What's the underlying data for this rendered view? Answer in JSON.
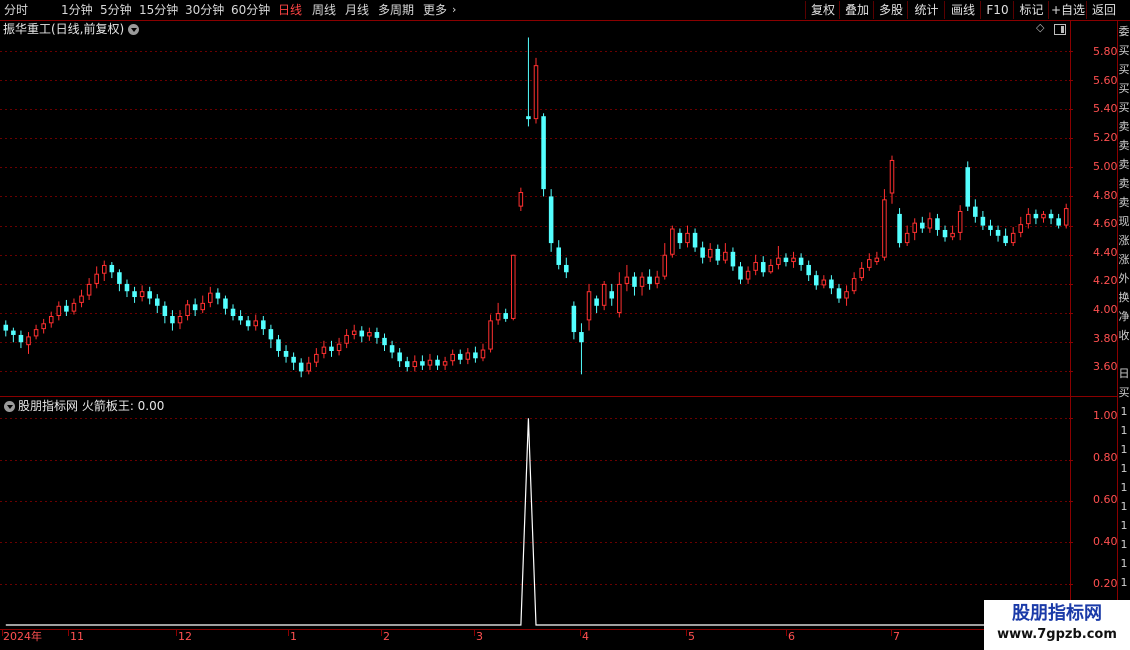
{
  "toolbar": {
    "timeframes": [
      "分时",
      "1分钟",
      "5分钟",
      "15分钟",
      "30分钟",
      "60分钟",
      "日线",
      "周线",
      "月线",
      "多周期",
      "更多"
    ],
    "active_timeframe": "日线",
    "buttons": [
      "复权",
      "叠加",
      "多股",
      "统计",
      "画线",
      "F10",
      "标记",
      "+自选",
      "返回"
    ]
  },
  "main_chart": {
    "title": "振华重工(日线,前复权)",
    "y_ticks": [
      "5.80",
      "5.60",
      "5.40",
      "5.20",
      "5.00",
      "4.80",
      "4.60",
      "4.40",
      "4.20",
      "4.00",
      "3.80",
      "3.60"
    ]
  },
  "indicator": {
    "title": "股朋指标网  火箭板王: 0.00",
    "y_ticks": [
      "1.00",
      "0.80",
      "0.60",
      "0.40",
      "0.20"
    ]
  },
  "x_axis": {
    "labels": [
      "2024年",
      "11",
      "12",
      "1",
      "2",
      "3",
      "4",
      "5",
      "6",
      "7"
    ]
  },
  "right_strip": {
    "chars": [
      "委",
      "买",
      "买",
      "买",
      "买",
      "卖",
      "卖",
      "卖",
      "卖",
      "卖",
      "现",
      "涨",
      "涨",
      "外",
      "换",
      "净",
      "收",
      "",
      "日",
      "买",
      "1",
      "1",
      "1",
      "1",
      "1",
      "1",
      "1",
      "1",
      "1",
      "1"
    ]
  },
  "watermark": {
    "title": "股朋指标网",
    "url": "www.7gpzb.com"
  },
  "colors": {
    "up": "#ff3030",
    "down": "#54ffff",
    "grid": "#6a0000",
    "frame": "#8a0000",
    "tick_label": "#ff5050",
    "indicator_line": "#ffffff"
  },
  "chart_data": {
    "type": "candlestick",
    "price_range": [
      3.5,
      5.9
    ],
    "indicator_range": [
      0,
      1.05
    ],
    "candles": [
      [
        3.92,
        3.88,
        3.95,
        3.84
      ],
      [
        3.88,
        3.85,
        3.9,
        3.8
      ],
      [
        3.85,
        3.8,
        3.88,
        3.76
      ],
      [
        3.78,
        3.84,
        3.87,
        3.72
      ],
      [
        3.84,
        3.89,
        3.92,
        3.82
      ],
      [
        3.89,
        3.93,
        3.96,
        3.86
      ],
      [
        3.93,
        3.98,
        4.01,
        3.9
      ],
      [
        3.98,
        4.05,
        4.08,
        3.95
      ],
      [
        4.05,
        4.01,
        4.09,
        3.98
      ],
      [
        4.01,
        4.07,
        4.1,
        3.99
      ],
      [
        4.07,
        4.12,
        4.16,
        4.04
      ],
      [
        4.12,
        4.2,
        4.24,
        4.09
      ],
      [
        4.2,
        4.27,
        4.32,
        4.17
      ],
      [
        4.27,
        4.33,
        4.36,
        4.22
      ],
      [
        4.33,
        4.28,
        4.35,
        4.24
      ],
      [
        4.28,
        4.2,
        4.3,
        4.15
      ],
      [
        4.2,
        4.15,
        4.23,
        4.11
      ],
      [
        4.15,
        4.11,
        4.18,
        4.07
      ],
      [
        4.11,
        4.15,
        4.19,
        4.08
      ],
      [
        4.15,
        4.1,
        4.18,
        4.06
      ],
      [
        4.1,
        4.05,
        4.13,
        4.0
      ],
      [
        4.05,
        3.98,
        4.08,
        3.93
      ],
      [
        3.98,
        3.93,
        4.02,
        3.88
      ],
      [
        3.93,
        3.98,
        4.02,
        3.89
      ],
      [
        3.98,
        4.06,
        4.09,
        3.95
      ],
      [
        4.06,
        4.02,
        4.1,
        3.98
      ],
      [
        4.02,
        4.07,
        4.12,
        4.0
      ],
      [
        4.07,
        4.14,
        4.18,
        4.04
      ],
      [
        4.14,
        4.1,
        4.17,
        4.06
      ],
      [
        4.1,
        4.03,
        4.12,
        3.99
      ],
      [
        4.03,
        3.98,
        4.06,
        3.95
      ],
      [
        3.98,
        3.95,
        4.02,
        3.92
      ],
      [
        3.95,
        3.91,
        3.98,
        3.88
      ],
      [
        3.91,
        3.95,
        3.99,
        3.88
      ],
      [
        3.95,
        3.89,
        3.98,
        3.85
      ],
      [
        3.89,
        3.82,
        3.92,
        3.76
      ],
      [
        3.82,
        3.74,
        3.85,
        3.7
      ],
      [
        3.74,
        3.7,
        3.78,
        3.66
      ],
      [
        3.7,
        3.66,
        3.73,
        3.61
      ],
      [
        3.66,
        3.6,
        3.69,
        3.56
      ],
      [
        3.6,
        3.66,
        3.7,
        3.58
      ],
      [
        3.66,
        3.72,
        3.76,
        3.63
      ],
      [
        3.72,
        3.77,
        3.81,
        3.69
      ],
      [
        3.77,
        3.74,
        3.81,
        3.7
      ],
      [
        3.74,
        3.79,
        3.83,
        3.71
      ],
      [
        3.79,
        3.85,
        3.89,
        3.76
      ],
      [
        3.85,
        3.88,
        3.92,
        3.82
      ],
      [
        3.88,
        3.84,
        3.91,
        3.8
      ],
      [
        3.84,
        3.87,
        3.9,
        3.81
      ],
      [
        3.87,
        3.83,
        3.9,
        3.79
      ],
      [
        3.83,
        3.78,
        3.86,
        3.74
      ],
      [
        3.78,
        3.73,
        3.81,
        3.69
      ],
      [
        3.73,
        3.67,
        3.76,
        3.63
      ],
      [
        3.67,
        3.63,
        3.7,
        3.6
      ],
      [
        3.63,
        3.67,
        3.71,
        3.6
      ],
      [
        3.67,
        3.64,
        3.71,
        3.61
      ],
      [
        3.64,
        3.68,
        3.72,
        3.61
      ],
      [
        3.68,
        3.64,
        3.71,
        3.61
      ],
      [
        3.64,
        3.67,
        3.7,
        3.61
      ],
      [
        3.67,
        3.72,
        3.75,
        3.64
      ],
      [
        3.72,
        3.68,
        3.75,
        3.65
      ],
      [
        3.68,
        3.73,
        3.76,
        3.65
      ],
      [
        3.73,
        3.69,
        3.77,
        3.66
      ],
      [
        3.69,
        3.75,
        3.79,
        3.67
      ],
      [
        3.75,
        3.95,
        3.99,
        3.73
      ],
      [
        3.95,
        4.0,
        4.07,
        3.92
      ],
      [
        4.0,
        3.96,
        4.03,
        3.94
      ],
      [
        3.96,
        4.4,
        4.4,
        3.95
      ],
      [
        4.73,
        4.83,
        4.86,
        4.7
      ],
      [
        5.35,
        5.33,
        5.89,
        5.28
      ],
      [
        5.33,
        5.7,
        5.75,
        5.3
      ],
      [
        5.35,
        4.85,
        5.37,
        4.8
      ],
      [
        4.8,
        4.48,
        4.85,
        4.42
      ],
      [
        4.45,
        4.33,
        4.5,
        4.3
      ],
      [
        4.33,
        4.28,
        4.38,
        4.24
      ],
      [
        4.05,
        3.87,
        4.08,
        3.82
      ],
      [
        3.87,
        3.8,
        3.93,
        3.58
      ],
      [
        3.95,
        4.15,
        4.2,
        3.88
      ],
      [
        4.1,
        4.05,
        4.12,
        4.0
      ],
      [
        4.05,
        4.2,
        4.22,
        4.02
      ],
      [
        4.15,
        4.1,
        4.2,
        4.05
      ],
      [
        4.0,
        4.2,
        4.28,
        3.97
      ],
      [
        4.2,
        4.25,
        4.33,
        4.15
      ],
      [
        4.25,
        4.18,
        4.28,
        4.12
      ],
      [
        4.18,
        4.25,
        4.28,
        4.12
      ],
      [
        4.25,
        4.2,
        4.3,
        4.16
      ],
      [
        4.2,
        4.25,
        4.29,
        4.17
      ],
      [
        4.25,
        4.4,
        4.48,
        4.23
      ],
      [
        4.4,
        4.58,
        4.6,
        4.38
      ],
      [
        4.55,
        4.48,
        4.58,
        4.44
      ],
      [
        4.48,
        4.55,
        4.6,
        4.45
      ],
      [
        4.55,
        4.45,
        4.58,
        4.42
      ],
      [
        4.45,
        4.38,
        4.49,
        4.34
      ],
      [
        4.38,
        4.44,
        4.48,
        4.35
      ],
      [
        4.44,
        4.36,
        4.47,
        4.33
      ],
      [
        4.36,
        4.42,
        4.48,
        4.34
      ],
      [
        4.42,
        4.32,
        4.45,
        4.29
      ],
      [
        4.32,
        4.23,
        4.35,
        4.2
      ],
      [
        4.23,
        4.29,
        4.32,
        4.2
      ],
      [
        4.29,
        4.35,
        4.4,
        4.26
      ],
      [
        4.35,
        4.28,
        4.39,
        4.25
      ],
      [
        4.28,
        4.33,
        4.37,
        4.27
      ],
      [
        4.33,
        4.38,
        4.46,
        4.3
      ],
      [
        4.38,
        4.35,
        4.41,
        4.32
      ],
      [
        4.35,
        4.38,
        4.42,
        4.31
      ],
      [
        4.38,
        4.33,
        4.41,
        4.29
      ],
      [
        4.33,
        4.26,
        4.36,
        4.22
      ],
      [
        4.26,
        4.19,
        4.29,
        4.16
      ],
      [
        4.19,
        4.23,
        4.26,
        4.17
      ],
      [
        4.23,
        4.17,
        4.26,
        4.13
      ],
      [
        4.17,
        4.1,
        4.2,
        4.07
      ],
      [
        4.1,
        4.15,
        4.19,
        4.05
      ],
      [
        4.15,
        4.24,
        4.28,
        4.13
      ],
      [
        4.24,
        4.31,
        4.35,
        4.22
      ],
      [
        4.31,
        4.37,
        4.41,
        4.29
      ],
      [
        4.35,
        4.38,
        4.42,
        4.33
      ],
      [
        4.38,
        4.78,
        4.85,
        4.36
      ],
      [
        4.82,
        5.05,
        5.08,
        4.75
      ],
      [
        4.68,
        4.48,
        4.72,
        4.45
      ],
      [
        4.48,
        4.55,
        4.6,
        4.46
      ],
      [
        4.55,
        4.62,
        4.65,
        4.5
      ],
      [
        4.62,
        4.58,
        4.66,
        4.55
      ],
      [
        4.58,
        4.65,
        4.69,
        4.55
      ],
      [
        4.65,
        4.57,
        4.68,
        4.53
      ],
      [
        4.57,
        4.52,
        4.6,
        4.49
      ],
      [
        4.52,
        4.55,
        4.6,
        4.5
      ],
      [
        4.55,
        4.7,
        4.74,
        4.5
      ],
      [
        5.0,
        4.73,
        5.04,
        4.7
      ],
      [
        4.73,
        4.66,
        4.78,
        4.62
      ],
      [
        4.66,
        4.6,
        4.7,
        4.57
      ],
      [
        4.6,
        4.57,
        4.64,
        4.53
      ],
      [
        4.57,
        4.53,
        4.6,
        4.49
      ],
      [
        4.53,
        4.48,
        4.58,
        4.46
      ],
      [
        4.48,
        4.55,
        4.59,
        4.46
      ],
      [
        4.55,
        4.61,
        4.66,
        4.52
      ],
      [
        4.61,
        4.68,
        4.72,
        4.58
      ],
      [
        4.68,
        4.65,
        4.71,
        4.61
      ],
      [
        4.65,
        4.68,
        4.7,
        4.62
      ],
      [
        4.68,
        4.65,
        4.71,
        4.61
      ],
      [
        4.65,
        4.6,
        4.68,
        4.58
      ],
      [
        4.6,
        4.72,
        4.75,
        4.58
      ]
    ],
    "indicator_series": [
      0,
      0,
      0,
      0,
      0,
      0,
      0,
      0,
      0,
      0,
      0,
      0,
      0,
      0,
      0,
      0,
      0,
      0,
      0,
      0,
      0,
      0,
      0,
      0,
      0,
      0,
      0,
      0,
      0,
      0,
      0,
      0,
      0,
      0,
      0,
      0,
      0,
      0,
      0,
      0,
      0,
      0,
      0,
      0,
      0,
      0,
      0,
      0,
      0,
      0,
      0,
      0,
      0,
      0,
      0,
      0,
      0,
      0,
      0,
      0,
      0,
      0,
      0,
      0,
      0,
      0,
      0,
      0,
      0,
      1,
      0,
      0,
      0,
      0,
      0,
      0,
      0,
      0,
      0,
      0,
      0,
      0,
      0,
      0,
      0,
      0,
      0,
      0,
      0,
      0,
      0,
      0,
      0,
      0,
      0,
      0,
      0,
      0,
      0,
      0,
      0,
      0,
      0,
      0,
      0,
      0,
      0,
      0,
      0,
      0,
      0,
      0,
      0,
      0,
      0,
      0,
      0,
      0,
      0,
      0,
      0,
      0,
      0,
      0,
      0,
      0,
      0,
      0,
      0,
      0,
      0,
      0,
      0,
      0,
      0,
      0,
      0,
      0,
      0,
      0,
      0,
      0,
      0,
      0,
      0,
      0
    ]
  }
}
